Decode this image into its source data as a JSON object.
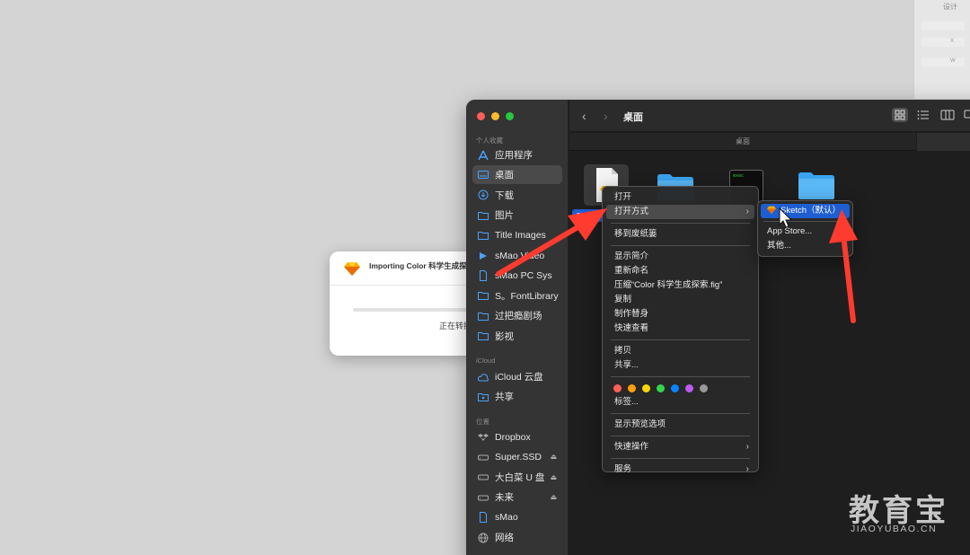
{
  "background_panel": {
    "title": "设计",
    "fields": [
      "X",
      "W"
    ]
  },
  "dialog": {
    "title": "Importing Color 科学生成探",
    "status": "正在转换",
    "progress": 0
  },
  "finder": {
    "window_title": "桌面",
    "path_label": "桌面",
    "sidebar": {
      "favorites_label": "个人收藏",
      "favorites": [
        {
          "label": "应用程序",
          "icon": "apps-icon"
        },
        {
          "label": "桌面",
          "icon": "desktop-icon",
          "selected": true
        },
        {
          "label": "下载",
          "icon": "download-icon"
        },
        {
          "label": "图片",
          "icon": "folder-icon"
        },
        {
          "label": "Title Images",
          "icon": "folder-icon"
        },
        {
          "label": "sMao Video",
          "icon": "app-icon"
        },
        {
          "label": "sMao PC Sys",
          "icon": "document-icon"
        },
        {
          "label": "S。FontLibrary",
          "icon": "folder-icon"
        },
        {
          "label": "过把瘾剧场",
          "icon": "folder-icon"
        },
        {
          "label": "影视",
          "icon": "folder-icon"
        }
      ],
      "icloud_label": "iCloud",
      "icloud": [
        {
          "label": "iCloud 云盘",
          "icon": "cloud-icon"
        },
        {
          "label": "共享",
          "icon": "shared-folder-icon"
        }
      ],
      "locations_label": "位置",
      "locations": [
        {
          "label": "Dropbox",
          "icon": "dropbox-icon"
        },
        {
          "label": "Super.SSD",
          "icon": "drive-icon",
          "eject": true
        },
        {
          "label": "大白菜 U 盘",
          "icon": "drive-icon",
          "eject": true
        },
        {
          "label": "未来",
          "icon": "drive-icon",
          "eject": true
        },
        {
          "label": "sMao",
          "icon": "document-icon"
        },
        {
          "label": "网络",
          "icon": "network-icon"
        }
      ]
    },
    "selected_file_label": "Color 科"
  },
  "context_menu": {
    "items": [
      {
        "label": "打开"
      },
      {
        "label": "打开方式",
        "submenu": true,
        "highlighted": true
      },
      {
        "sep": true
      },
      {
        "label": "移到废纸篓"
      },
      {
        "sep": true
      },
      {
        "label": "显示简介"
      },
      {
        "label": "重新命名"
      },
      {
        "label": "压缩“Color 科学生成探索.fig”"
      },
      {
        "label": "复制"
      },
      {
        "label": "制作替身"
      },
      {
        "label": "快速查看"
      },
      {
        "sep": true
      },
      {
        "label": "拷贝"
      },
      {
        "label": "共享..."
      },
      {
        "sep": true
      },
      {
        "tags": true
      },
      {
        "label": "标签..."
      },
      {
        "sep": true
      },
      {
        "label": "显示预览选项"
      },
      {
        "sep": true
      },
      {
        "label": "快速操作",
        "submenu": true
      },
      {
        "sep": true
      },
      {
        "label": "服务",
        "submenu": true
      }
    ],
    "tag_colors": [
      "#ff5f57",
      "#ff9f0a",
      "#ffd60a",
      "#32d74b",
      "#0a84ff",
      "#bf5af2",
      "#98989d"
    ]
  },
  "submenu": {
    "items": [
      "Sketch（默认）",
      "App Store...",
      "其他..."
    ]
  },
  "watermark": {
    "text": "教育宝",
    "subtext": "JIAOYUBAO.CN"
  },
  "colors": {
    "accent_blue": "#1f5ed1",
    "folder_blue": "#3aa4f0",
    "arrow_red": "#ff3b2f"
  }
}
